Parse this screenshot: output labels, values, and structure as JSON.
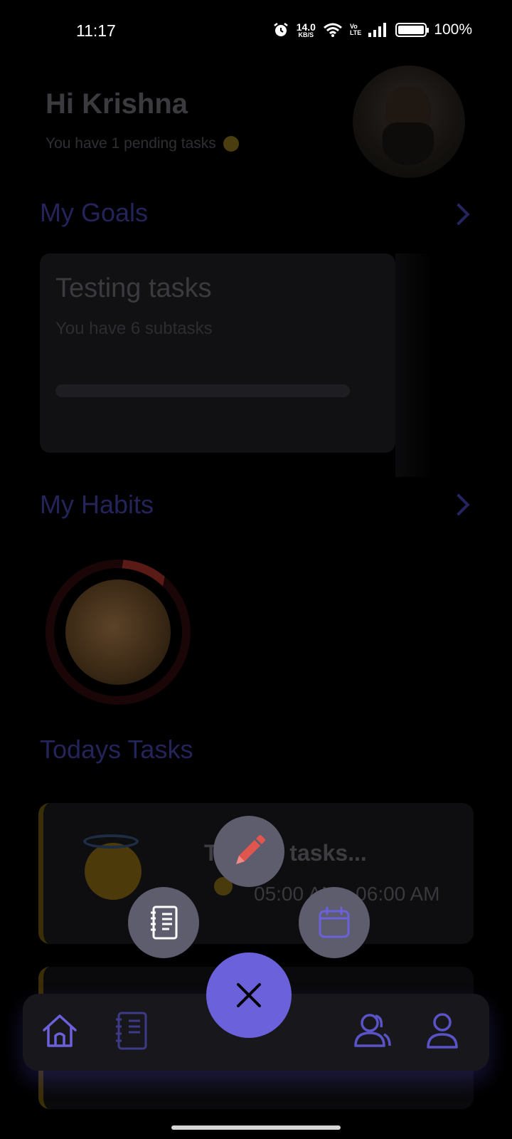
{
  "status_bar": {
    "time": "11:17",
    "net_speed_value": "14.0",
    "net_speed_unit": "KB/S",
    "volte_top": "Vo",
    "volte_bottom": "LTE",
    "battery_percent": "100%"
  },
  "header": {
    "greeting": "Hi Krishna",
    "pending_text": "You have 1 pending tasks"
  },
  "goals": {
    "title": "My Goals",
    "card": {
      "title": "Testing tasks",
      "subtitle": "You have 6 subtasks",
      "progress": 0
    }
  },
  "habits": {
    "title": "My Habits",
    "progress_ring_color": "#5a1a16"
  },
  "tasks": {
    "title": "Todays Tasks",
    "items": [
      {
        "title": "Testing tasks...",
        "time": "05:00 AM - 06:00 AM"
      }
    ]
  },
  "speed_dial": {
    "actions": [
      {
        "icon": "pencil-icon"
      },
      {
        "icon": "notebook-icon"
      },
      {
        "icon": "calendar-icon"
      }
    ],
    "close_icon": "close-icon"
  },
  "bottom_nav": {
    "items": [
      {
        "icon": "home-icon"
      },
      {
        "icon": "notebook-icon"
      },
      {
        "icon": "people-icon"
      },
      {
        "icon": "profile-icon"
      }
    ]
  },
  "colors": {
    "accent": "#6b61db",
    "fab_small": "#5e5d6e",
    "pencil": "#e0564f"
  }
}
